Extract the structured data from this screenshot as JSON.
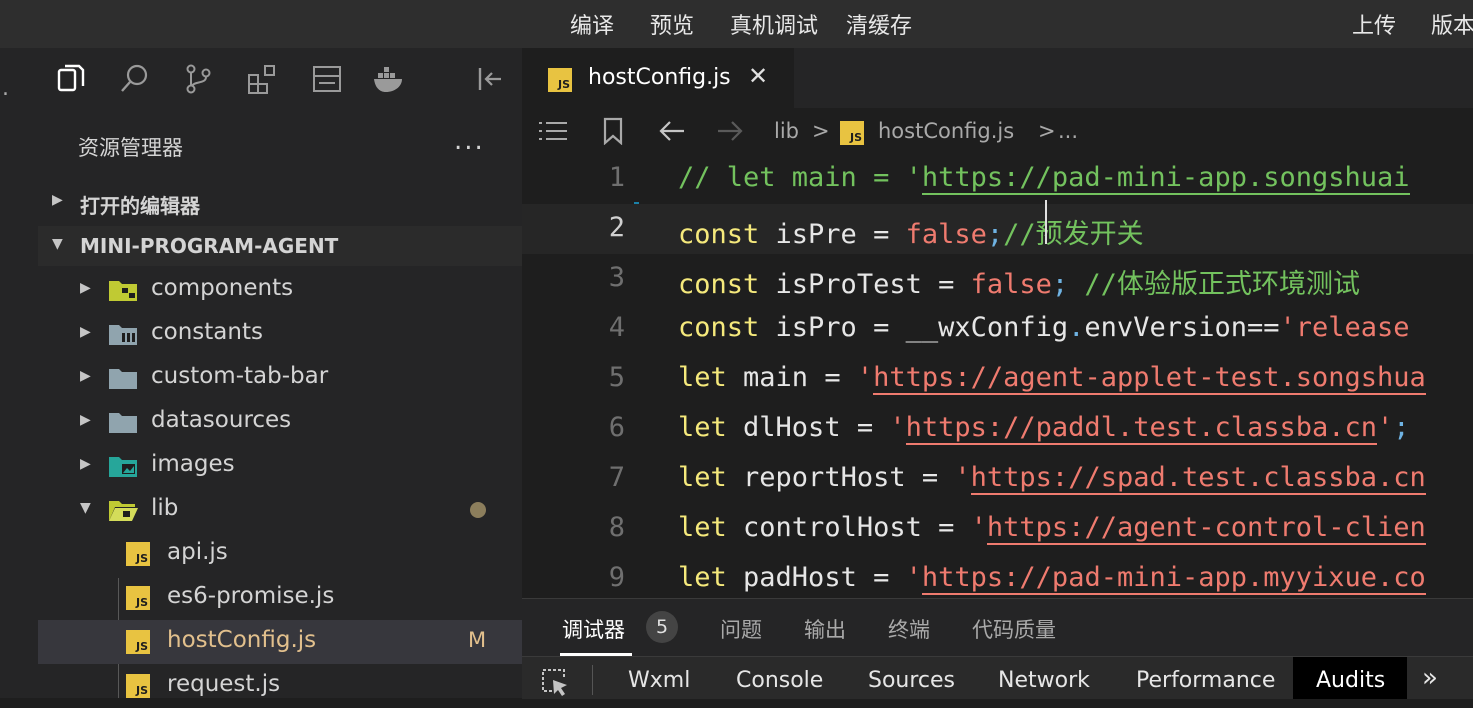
{
  "topbar": {
    "compile": "编译",
    "preview": "预览",
    "real_debug": "真机调试",
    "clear_cache": "清缓存",
    "upload": "上传",
    "version": "版本"
  },
  "leftstrip": {
    "dot": "."
  },
  "sidebar": {
    "icons": [
      "files-icon",
      "search-icon",
      "source-control-icon",
      "extensions-icon",
      "layout-icon",
      "docker-icon",
      "collapse-sidebar-icon"
    ],
    "title": "资源管理器",
    "more": "...",
    "open_editors": "打开的编辑器",
    "project": "MINI-PROGRAM-AGENT",
    "tree": [
      {
        "name": "components",
        "type": "folder",
        "icon": "components-folder-icon",
        "color": "#c0ca33"
      },
      {
        "name": "constants",
        "type": "folder",
        "icon": "constants-folder-icon",
        "color": "#90a4ae"
      },
      {
        "name": "custom-tab-bar",
        "type": "folder",
        "icon": "folder-icon",
        "color": "#90a4ae"
      },
      {
        "name": "datasources",
        "type": "folder",
        "icon": "folder-icon",
        "color": "#90a4ae"
      },
      {
        "name": "images",
        "type": "folder",
        "icon": "images-folder-icon",
        "color": "#26a69a"
      },
      {
        "name": "lib",
        "type": "folder-open",
        "icon": "lib-folder-icon",
        "color": "#c0ca33"
      },
      {
        "name": "api.js",
        "type": "file"
      },
      {
        "name": "es6-promise.js",
        "type": "file"
      },
      {
        "name": "hostConfig.js",
        "type": "file",
        "selected": true,
        "status": "M"
      },
      {
        "name": "request.js",
        "type": "file"
      }
    ],
    "js_badge": "JS"
  },
  "editor": {
    "tab_label": "hostConfig.js",
    "tab_close": "✕",
    "breadcrumb": {
      "folder": "lib",
      "sep": ">",
      "file": "hostConfig.js",
      "more": "..."
    },
    "lines": [
      {
        "n": "1",
        "parts": [
          {
            "c": "cm",
            "t": "// let main = '"
          },
          {
            "c": "url-green",
            "t": "https://pad-mini-app.songshuai"
          }
        ]
      },
      {
        "n": "2",
        "parts": [
          {
            "c": "kw",
            "t": "const"
          },
          {
            "c": "pl",
            "t": " isPre "
          },
          {
            "c": "op",
            "t": "="
          },
          {
            "c": "pl",
            "t": " "
          },
          {
            "c": "bool",
            "t": "false"
          },
          {
            "c": "punc-blue",
            "t": ";"
          },
          {
            "c": "cm",
            "t": "//预发开关"
          }
        ]
      },
      {
        "n": "3",
        "parts": [
          {
            "c": "kw",
            "t": "const"
          },
          {
            "c": "pl",
            "t": " isProTest "
          },
          {
            "c": "op",
            "t": "="
          },
          {
            "c": "pl",
            "t": " "
          },
          {
            "c": "bool",
            "t": "false"
          },
          {
            "c": "punc-blue",
            "t": ";"
          },
          {
            "c": "cm",
            "t": " //体验版正式环境测试"
          }
        ]
      },
      {
        "n": "4",
        "parts": [
          {
            "c": "kw",
            "t": "const"
          },
          {
            "c": "pl",
            "t": " isPro "
          },
          {
            "c": "op",
            "t": "="
          },
          {
            "c": "pl",
            "t": " __wxConfig"
          },
          {
            "c": "punc-blue",
            "t": "."
          },
          {
            "c": "pl",
            "t": "envVersion"
          },
          {
            "c": "op",
            "t": "=="
          },
          {
            "c": "str",
            "t": "'release"
          }
        ]
      },
      {
        "n": "5",
        "parts": [
          {
            "c": "kw",
            "t": "let"
          },
          {
            "c": "pl",
            "t": " main "
          },
          {
            "c": "op",
            "t": "="
          },
          {
            "c": "pl",
            "t": " "
          },
          {
            "c": "str",
            "t": "'"
          },
          {
            "c": "url-red",
            "t": "https://agent-applet-test.songshua"
          }
        ]
      },
      {
        "n": "6",
        "parts": [
          {
            "c": "kw",
            "t": "let"
          },
          {
            "c": "pl",
            "t": " dlHost "
          },
          {
            "c": "op",
            "t": "="
          },
          {
            "c": "pl",
            "t": " "
          },
          {
            "c": "str",
            "t": "'"
          },
          {
            "c": "url-red",
            "t": "https://paddl.test.classba.cn"
          },
          {
            "c": "str",
            "t": "'"
          },
          {
            "c": "punc-blue",
            "t": ";"
          }
        ]
      },
      {
        "n": "7",
        "parts": [
          {
            "c": "kw",
            "t": "let"
          },
          {
            "c": "pl",
            "t": " reportHost "
          },
          {
            "c": "op",
            "t": "="
          },
          {
            "c": "pl",
            "t": " "
          },
          {
            "c": "str",
            "t": "'"
          },
          {
            "c": "url-red",
            "t": "https://spad.test.classba.cn"
          }
        ]
      },
      {
        "n": "8",
        "parts": [
          {
            "c": "kw",
            "t": "let"
          },
          {
            "c": "pl",
            "t": " controlHost "
          },
          {
            "c": "op",
            "t": "="
          },
          {
            "c": "pl",
            "t": " "
          },
          {
            "c": "str",
            "t": "'"
          },
          {
            "c": "url-red",
            "t": "https://agent-control-clien"
          }
        ]
      },
      {
        "n": "9",
        "parts": [
          {
            "c": "kw",
            "t": "let"
          },
          {
            "c": "pl",
            "t": " padHost "
          },
          {
            "c": "op",
            "t": "="
          },
          {
            "c": "pl",
            "t": " "
          },
          {
            "c": "str",
            "t": "'"
          },
          {
            "c": "url-red",
            "t": "https://pad-mini-app.myyixue.co"
          }
        ]
      }
    ]
  },
  "panel": {
    "tabs": [
      "调试器",
      "问题",
      "输出",
      "终端",
      "代码质量"
    ],
    "badge": "5"
  },
  "devtools": {
    "tabs": [
      "Wxml",
      "Console",
      "Sources",
      "Network",
      "Performance",
      "Audits"
    ],
    "more": "»"
  }
}
